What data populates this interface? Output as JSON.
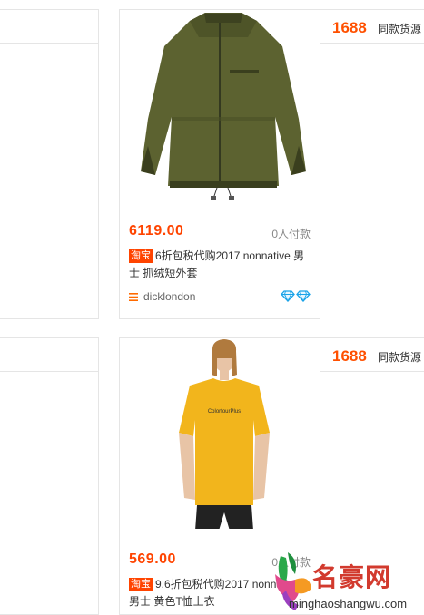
{
  "products": [
    {
      "image_alt": "olive green fleece jacket",
      "price": "6119.00",
      "sold": "0人付款",
      "tag": "淘宝",
      "title": "6折包税代购2017 nonnative 男士 抓绒短外套",
      "shop": "dicklondon",
      "source_price": "1688",
      "source_label": "同款货源"
    },
    {
      "image_alt": "yellow t-shirt on model",
      "print_text": "ColorfourPlus",
      "price": "569.00",
      "sold": "0人付款",
      "tag": "淘宝",
      "title": "9.6折包税代购2017 nonnative 男士 黄色T恤上衣",
      "source_price": "1688",
      "source_label": "同款货源"
    }
  ],
  "watermark": {
    "text": "名豪网",
    "url": "minghaoshangwu.com"
  },
  "colors": {
    "price": "#ff4400",
    "tag_bg": "#ff4400",
    "border": "#e5e5e5",
    "diamond": "#1aa3e8"
  }
}
